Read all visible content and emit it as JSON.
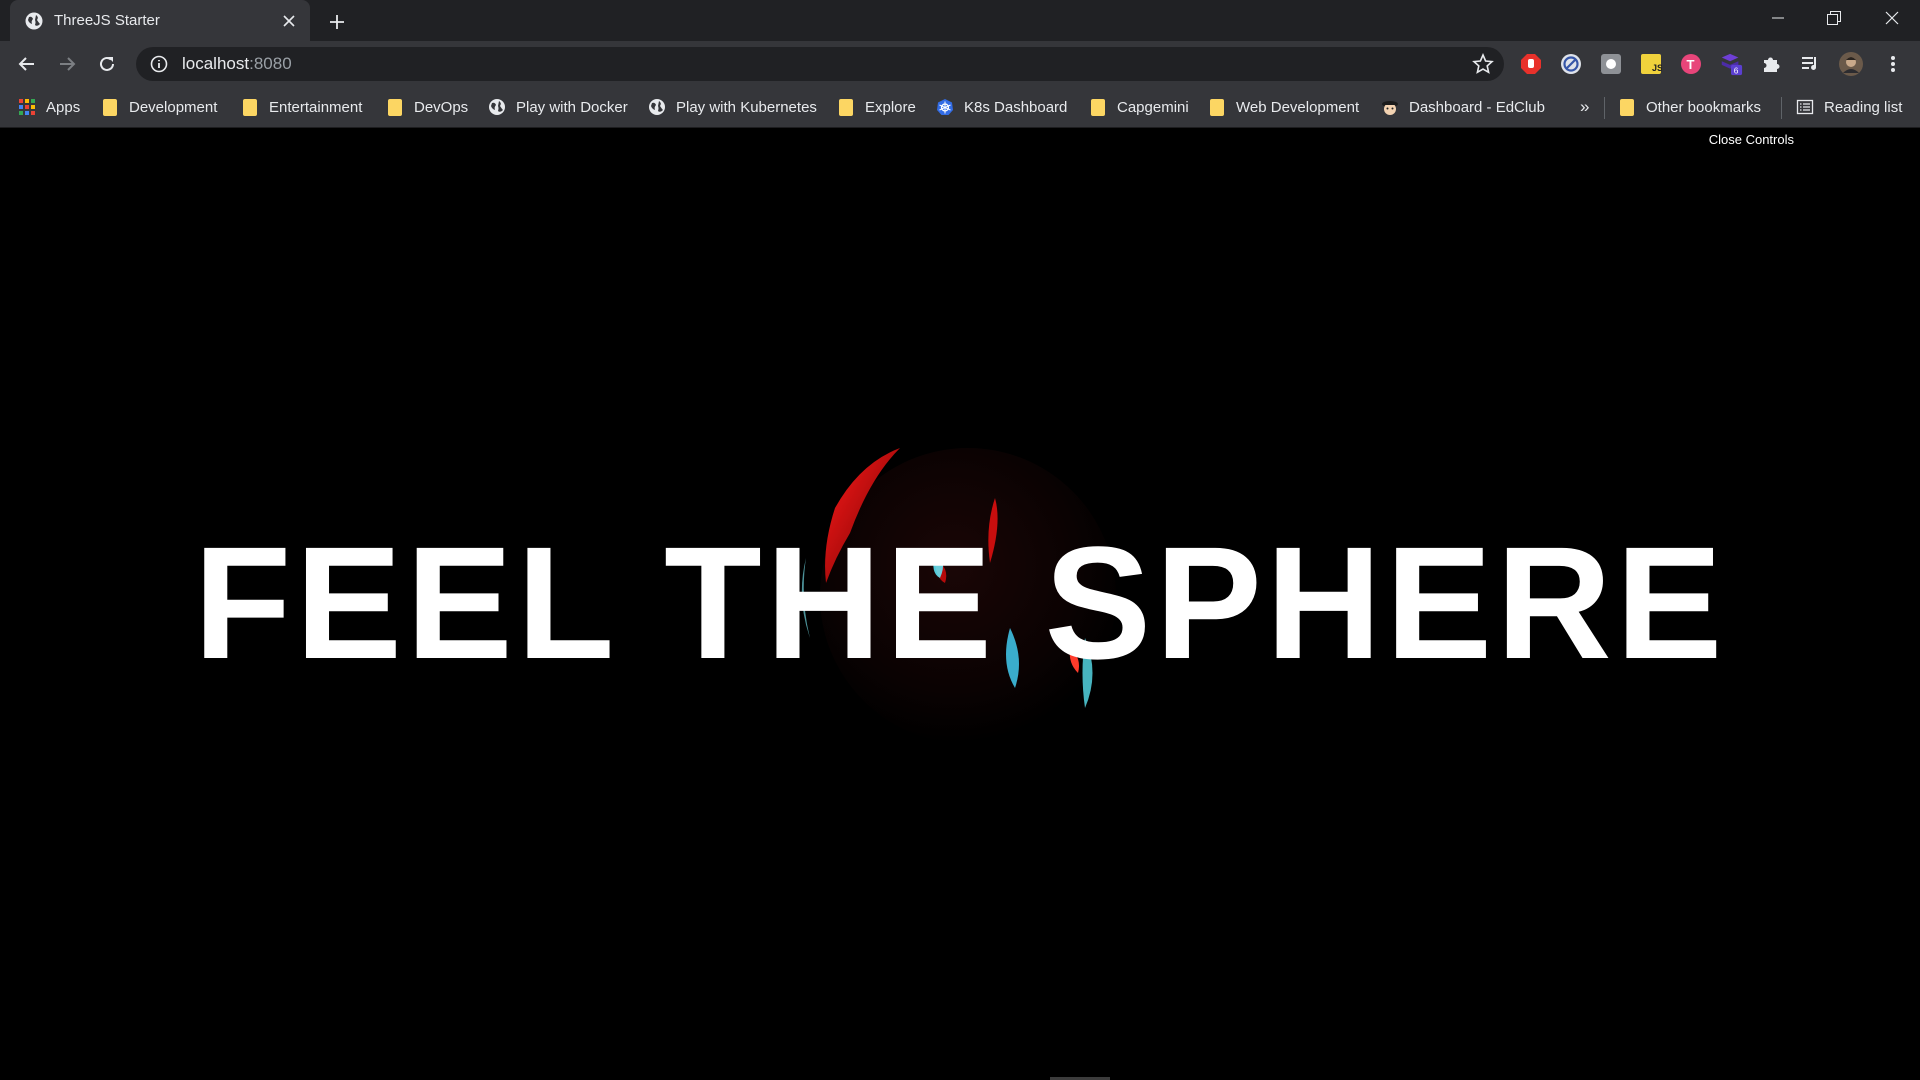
{
  "tab": {
    "title": "ThreeJS Starter"
  },
  "omnibox": {
    "host": "localhost",
    "port": ":8080"
  },
  "bookmarks": [
    {
      "label": "Apps",
      "icon": "apps-grid-icon"
    },
    {
      "label": "Development",
      "icon": "folder-icon"
    },
    {
      "label": "Entertainment",
      "icon": "folder-icon"
    },
    {
      "label": "DevOps",
      "icon": "folder-icon"
    },
    {
      "label": "Play with Docker",
      "icon": "globe-icon"
    },
    {
      "label": "Play with Kubernetes",
      "icon": "globe-icon"
    },
    {
      "label": "Explore",
      "icon": "folder-icon"
    },
    {
      "label": "K8s Dashboard",
      "icon": "kubernetes-icon"
    },
    {
      "label": "Capgemini",
      "icon": "folder-icon"
    },
    {
      "label": "Web Development",
      "icon": "folder-icon"
    },
    {
      "label": "Dashboard - EdClub",
      "icon": "edclub-icon"
    }
  ],
  "bookmarks_overflow": "»",
  "other_bookmarks": "Other bookmarks",
  "reading_list": "Reading list",
  "extensions": {
    "badge_count": "6"
  },
  "page": {
    "headline": "FEEL THE SPHERE",
    "close_controls": "Close Controls"
  },
  "colors": {
    "titlebar": "#202124",
    "toolbar": "#35363a",
    "folder": "#fcd663",
    "sphere_red": "#ff1a1a",
    "sphere_cyan": "#5ff0ff"
  }
}
